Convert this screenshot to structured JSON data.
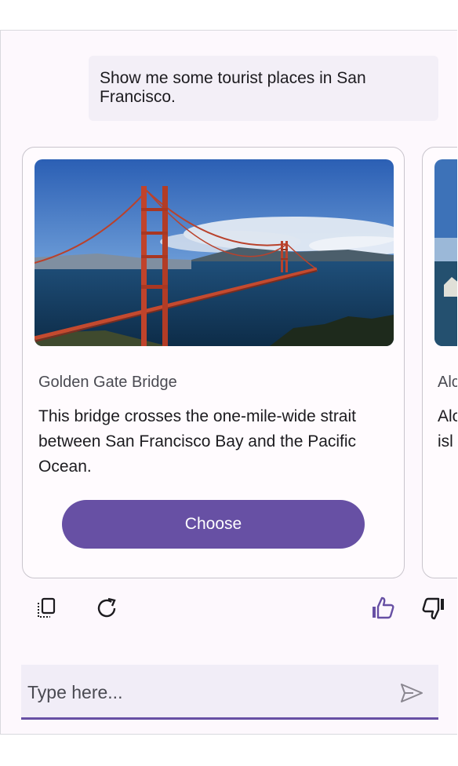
{
  "conversation": {
    "user_message": "Show me some tourist places in San Francisco."
  },
  "cards": [
    {
      "title": "Golden Gate Bridge",
      "description": "This bridge crosses the one-mile-wide strait between San Francisco Bay and the Pacific Ocean.",
      "button_label": "Choose"
    },
    {
      "title": "Alc",
      "description_lines": [
        "Alc",
        "isl"
      ]
    }
  ],
  "actions": {
    "copy_icon": "copy-icon",
    "regenerate_icon": "refresh-icon",
    "thumbs_up_icon": "thumbs-up-icon",
    "thumbs_down_icon": "thumbs-down-icon"
  },
  "composer": {
    "placeholder": "Type here...",
    "value": ""
  },
  "colors": {
    "accent": "#6750a4",
    "background": "#fdf8fd",
    "bubble": "#f3eff7"
  }
}
